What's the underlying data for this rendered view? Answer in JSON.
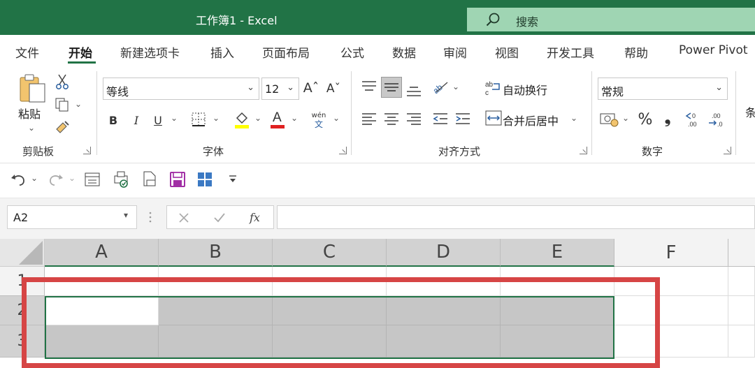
{
  "window": {
    "title": "工作簿1  -  Excel"
  },
  "search": {
    "label": "搜索"
  },
  "tabs": [
    {
      "label": "文件",
      "active": false
    },
    {
      "label": "开始",
      "active": true
    },
    {
      "label": "新建选项卡",
      "active": false
    },
    {
      "label": "插入",
      "active": false
    },
    {
      "label": "页面布局",
      "active": false
    },
    {
      "label": "公式",
      "active": false
    },
    {
      "label": "数据",
      "active": false
    },
    {
      "label": "审阅",
      "active": false
    },
    {
      "label": "视图",
      "active": false
    },
    {
      "label": "开发工具",
      "active": false
    },
    {
      "label": "帮助",
      "active": false
    },
    {
      "label": "Power Pivot",
      "active": false
    }
  ],
  "ribbon": {
    "clipboard": {
      "label": "剪贴板",
      "paste_label": "粘贴"
    },
    "font": {
      "label": "字体",
      "font_name": "等线",
      "font_size": "12",
      "bold": "B",
      "italic": "I",
      "underline": "U",
      "phonetic_top": "wén",
      "phonetic_bottom": "文"
    },
    "alignment": {
      "label": "对齐方式",
      "wrap_text": "自动换行",
      "merge_center": "合并后居中"
    },
    "number": {
      "label": "数字",
      "format": "常规",
      "percent": "%",
      "comma": "❟"
    },
    "styles_partial": "条"
  },
  "formula_bar": {
    "name_box": "A2",
    "formula": ""
  },
  "grid": {
    "columns": [
      "A",
      "B",
      "C",
      "D",
      "E",
      "F"
    ],
    "rows": [
      "1",
      "2",
      "3"
    ],
    "selected_range": "A2:E3",
    "active_cell": "A2"
  },
  "colors": {
    "brand_green": "#217346",
    "search_bg": "#9fd5b3",
    "selection_fill": "#c6c6c6",
    "annotation_red": "#d64545"
  }
}
